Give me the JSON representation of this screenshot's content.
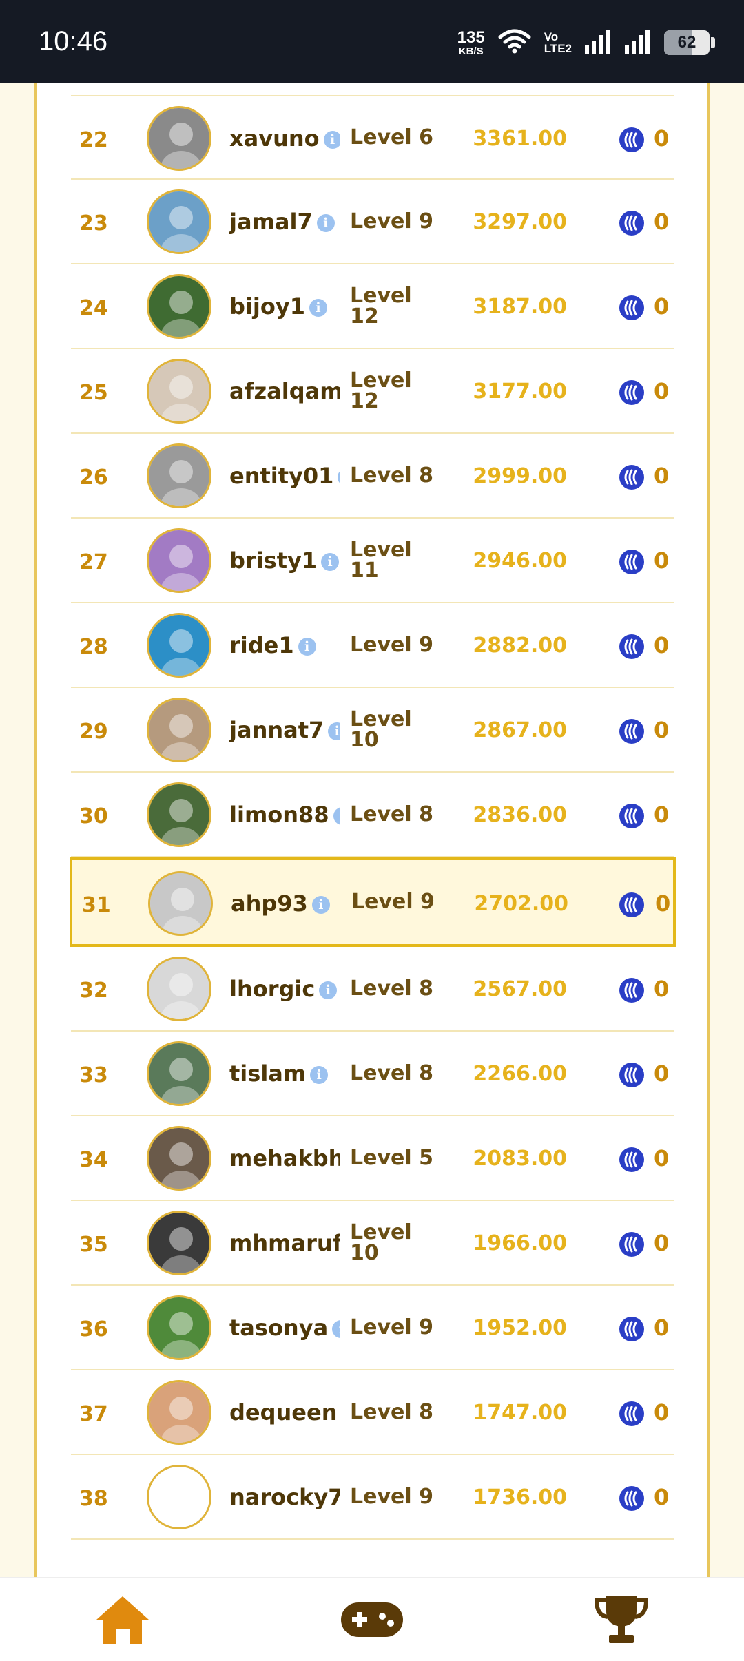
{
  "status_bar": {
    "time": "10:46",
    "net_speed_value": "135",
    "net_speed_unit": "KB/S",
    "volte_top": "Vo",
    "volte_bottom": "LTE2",
    "battery_percent": "62"
  },
  "colors": {
    "rank": "#c98a0a",
    "score": "#e6b21c",
    "name": "#4e3708",
    "highlight_border": "#e3b81a",
    "highlight_bg": "#fff8dc",
    "coin": "#2a3ec6",
    "nav_brown": "#5a3a08",
    "nav_orange": "#e08a0e"
  },
  "leaderboard": {
    "rows": [
      {
        "rank": "22",
        "name": "xavuno",
        "level": "Level 6",
        "score": "3361.00",
        "coins": "0",
        "avatar_color": "#8a8a8a"
      },
      {
        "rank": "23",
        "name": "jamal7",
        "level": "Level 9",
        "score": "3297.00",
        "coins": "0",
        "avatar_color": "#6ca0c8"
      },
      {
        "rank": "24",
        "name": "bijoy1",
        "level": "Level 12",
        "score": "3187.00",
        "coins": "0",
        "avatar_color": "#3f6b32"
      },
      {
        "rank": "25",
        "name": "afzalqam",
        "level": "Level 12",
        "score": "3177.00",
        "coins": "0",
        "avatar_color": "#d6c8b8"
      },
      {
        "rank": "26",
        "name": "entity01",
        "level": "Level 8",
        "score": "2999.00",
        "coins": "0",
        "avatar_color": "#9a9a9a"
      },
      {
        "rank": "27",
        "name": "bristy1",
        "level": "Level 11",
        "score": "2946.00",
        "coins": "0",
        "avatar_color": "#a27bc4"
      },
      {
        "rank": "28",
        "name": "ride1",
        "level": "Level 9",
        "score": "2882.00",
        "coins": "0",
        "avatar_color": "#2c8fc7"
      },
      {
        "rank": "29",
        "name": "jannat7",
        "level": "Level 10",
        "score": "2867.00",
        "coins": "0",
        "avatar_color": "#b59a7e"
      },
      {
        "rank": "30",
        "name": "limon88",
        "level": "Level 8",
        "score": "2836.00",
        "coins": "0",
        "avatar_color": "#4a6b3a"
      },
      {
        "rank": "31",
        "name": "ahp93",
        "level": "Level 9",
        "score": "2702.00",
        "coins": "0",
        "avatar_color": "#c8c8c8",
        "highlight": true
      },
      {
        "rank": "32",
        "name": "lhorgic",
        "level": "Level 8",
        "score": "2567.00",
        "coins": "0",
        "avatar_color": "#d8d8d8"
      },
      {
        "rank": "33",
        "name": "tislam",
        "level": "Level 8",
        "score": "2266.00",
        "coins": "0",
        "avatar_color": "#5a7a5a"
      },
      {
        "rank": "34",
        "name": "mehakbh",
        "level": "Level 5",
        "score": "2083.00",
        "coins": "0",
        "avatar_color": "#6a5a4a"
      },
      {
        "rank": "35",
        "name": "mhmaruf",
        "level": "Level 10",
        "score": "1966.00",
        "coins": "0",
        "avatar_color": "#3a3a3a"
      },
      {
        "rank": "36",
        "name": "tasonya",
        "level": "Level 9",
        "score": "1952.00",
        "coins": "0",
        "avatar_color": "#4f8a3a"
      },
      {
        "rank": "37",
        "name": "dequeen",
        "level": "Level 8",
        "score": "1747.00",
        "coins": "0",
        "avatar_color": "#d9a27a"
      },
      {
        "rank": "38",
        "name": "narocky7",
        "level": "Level 9",
        "score": "1736.00",
        "coins": "0",
        "avatar_color": "#ffffff"
      }
    ]
  },
  "bottom_nav": {
    "items": [
      {
        "name": "home",
        "icon": "home-icon"
      },
      {
        "name": "games",
        "icon": "gamepad-icon"
      },
      {
        "name": "leaderboard",
        "icon": "trophy-icon"
      }
    ]
  }
}
